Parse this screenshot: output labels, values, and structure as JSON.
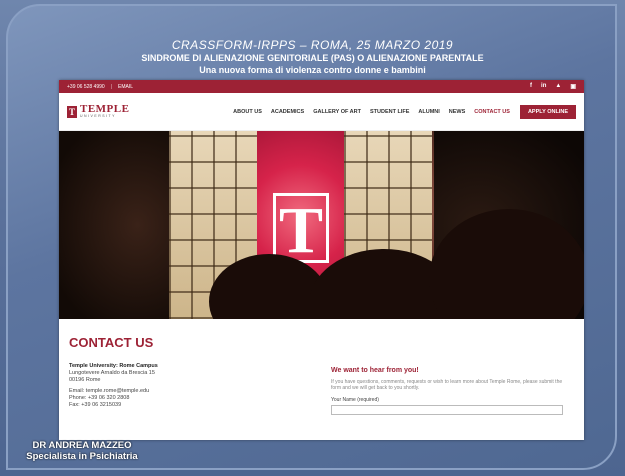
{
  "slide": {
    "title_line1": "CRASSFORM-IRPPS – ROMA, 25 MARZO 2019",
    "title_line2": "SINDROME DI ALIENAZIONE GENITORIALE (PAS) O ALIENAZIONE PARENTALE",
    "title_line3": "Una nuova forma di violenza contro donne e bambini",
    "author_line1": "DR ANDREA MAZZEO",
    "author_line2": "Specialista in Psichiatria"
  },
  "website": {
    "topbar": {
      "phone": "+39 06 528 4990",
      "email": "EMAIL",
      "social": [
        "f",
        "in",
        "▲",
        "▣"
      ]
    },
    "logo": {
      "mark": "T",
      "name": "TEMPLE",
      "subtitle": "UNIVERSITY"
    },
    "menu": [
      "ABOUT US",
      "ACADEMICS",
      "GALLERY OF ART",
      "STUDENT LIFE",
      "ALUMNI",
      "NEWS",
      "CONTACT US"
    ],
    "active_menu": "CONTACT US",
    "apply_button": "APPLY ONLINE",
    "hero": {
      "emblem": "T"
    },
    "contact": {
      "title": "CONTACT US",
      "campus_name": "Temple University: Rome Campus",
      "address_line1": "Lungotevere Arnaldo da Brescia 15",
      "address_line2": "00196 Rome",
      "email": "Email: temple.rome@temple.edu",
      "phone": "Phone: +39 06 320 2808",
      "fax": "Fax: +39 06 3215039",
      "form_heading": "We want to hear from you!",
      "form_intro": "If you have questions, comments, requests or wish to learn more about Temple Rome, please submit the form and we will get back to you shortly.",
      "name_label": "Your Name (required)",
      "name_value": ""
    }
  }
}
